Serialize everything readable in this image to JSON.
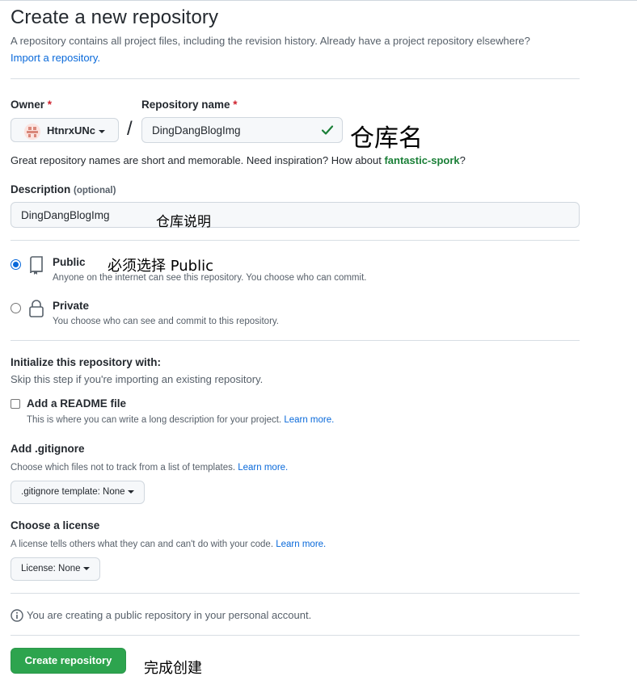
{
  "page": {
    "title": "Create a new repository",
    "subtitle": "A repository contains all project files, including the revision history. Already have a project repository elsewhere?",
    "import_link": "Import a repository."
  },
  "owner": {
    "label": "Owner",
    "required_mark": "*",
    "value": "HtnrxUNc"
  },
  "separator": "/",
  "repo_name": {
    "label": "Repository name",
    "required_mark": "*",
    "value": "DingDangBlogImg",
    "valid_icon": "check-icon"
  },
  "name_hint": {
    "text": "Great repository names are short and memorable. Need inspiration? How about ",
    "suggestion": "fantastic-spork",
    "suffix": "?"
  },
  "description": {
    "label": "Description",
    "optional": "(optional)",
    "value": "DingDangBlogImg"
  },
  "visibility": {
    "public": {
      "title": "Public",
      "desc": "Anyone on the internet can see this repository. You choose who can commit.",
      "selected": true,
      "icon": "repo-icon"
    },
    "private": {
      "title": "Private",
      "desc": "You choose who can see and commit to this repository.",
      "selected": false,
      "icon": "lock-icon"
    }
  },
  "initialize": {
    "title": "Initialize this repository with:",
    "subtitle": "Skip this step if you're importing an existing repository.",
    "readme": {
      "label": "Add a README file",
      "desc": "This is where you can write a long description for your project.",
      "link": "Learn more.",
      "checked": false
    }
  },
  "gitignore": {
    "title": "Add .gitignore",
    "desc": "Choose which files not to track from a list of templates.",
    "link": "Learn more.",
    "button_prefix": ".gitignore template:",
    "button_value": "None"
  },
  "license": {
    "title": "Choose a license",
    "desc": "A license tells others what they can and can't do with your code.",
    "link": "Learn more.",
    "button_prefix": "License:",
    "button_value": "None"
  },
  "notice": {
    "icon": "info-icon",
    "text": "You are creating a public repository in your personal account."
  },
  "submit": {
    "label": "Create repository"
  },
  "annotations": {
    "repo_name": "仓库名",
    "description": "仓库说明",
    "public": "必须选择 Public",
    "create": "完成创建"
  },
  "colors": {
    "primary_button": "#2da44e",
    "link": "#0969da",
    "valid_check": "#1a7f37",
    "required": "#cf222e"
  }
}
